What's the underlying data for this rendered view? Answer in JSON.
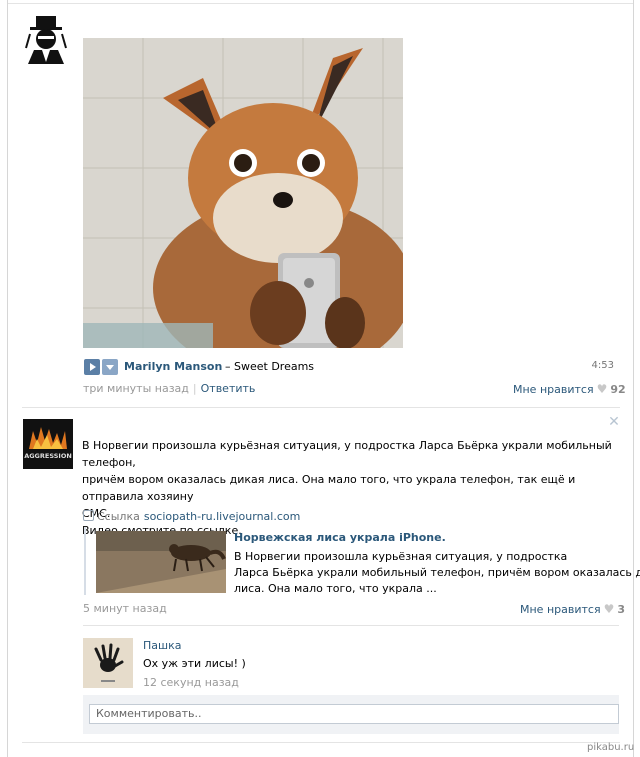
{
  "post1": {
    "audio": {
      "artist": "Marilyn Manson",
      "dash_title": "– Sweet Dreams",
      "duration": "4:53"
    },
    "time": "три минуты назад",
    "reply_label": "Ответить",
    "like_label": "Мне нравится",
    "like_count": "92"
  },
  "post2": {
    "text": [
      "В Норвегии произошла курьёзная ситуация, у подростка Ларса Бьёрка украли мобильный телефон,",
      "причём вором оказалась дикая лиса. Она мало того, что украла телефон, так ещё и отправила хозяину",
      "СМС.",
      "Видео смотрите по ссылке."
    ],
    "link_prefix": "Ссылка",
    "link_domain": "sociopath-ru.livejournal.com",
    "snippet": {
      "title": "Норвежская лиса украла iPhone.",
      "body": [
        "В Норвегии произошла курьёзная ситуация, у подростка",
        "Ларса Бьёрка украли мобильный телефон, причём вором оказалась дикая",
        "лиса. Она мало того, что украла ..."
      ]
    },
    "time": "5 минут назад",
    "like_label": "Мне нравится",
    "like_count": "3",
    "avatar_label": "AGGRESSION"
  },
  "comment": {
    "author": "Пашка",
    "text": "Ох уж эти лисы! )",
    "time": "12 секунд назад",
    "input_placeholder": "Комментировать.."
  },
  "watermark": "pikabu.ru",
  "colors": {
    "link": "#2b587a",
    "muted": "#999999",
    "accent_button": "#5b7fa6"
  }
}
